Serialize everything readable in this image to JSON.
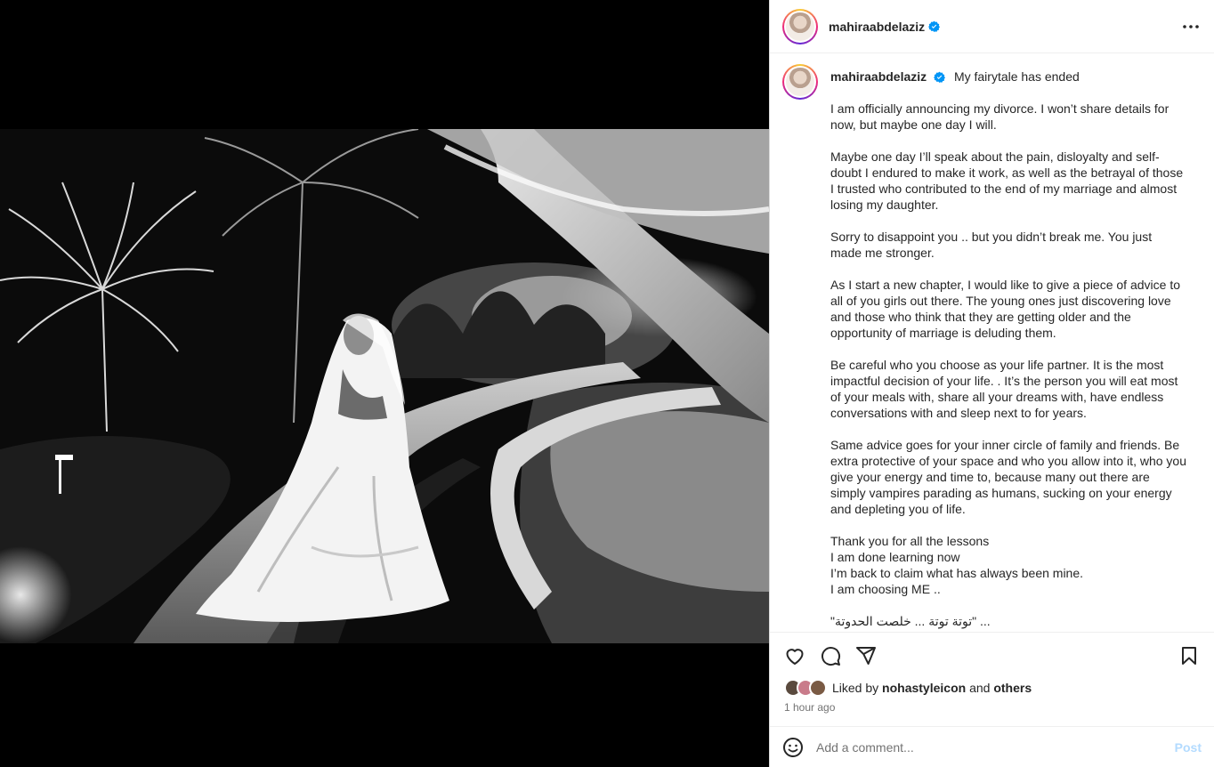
{
  "post": {
    "username": "mahiraabdelaziz",
    "more_icon": "more-horizontal-icon",
    "verified_color": "#0095f6"
  },
  "caption": {
    "username": "mahiraabdelaziz",
    "title": "My fairytale has ended",
    "text": "I am officially announcing my divorce. I won’t share details for now, but maybe one day I will.\n\nMaybe one day I’ll speak about the pain, disloyalty and self-doubt I endured to make it work, as well as the betrayal of those I trusted who contributed to the end of my marriage and almost losing my daughter.\n\nSorry to disappoint you .. but you didn’t break me. You just made me stronger.\n\nAs I start a new chapter, I would like to give a piece of advice to all of you girls out there. The young ones just discovering love and those who think that they are getting older and the opportunity of marriage is deluding them.\n\nBe careful who you choose as your life partner. It is the most impactful decision of your life. . It’s the person you will eat most of your meals with, share all your dreams with, have endless conversations with and sleep next to for years.\n\nSame advice goes for your inner circle of family and friends. Be extra protective of your space and who you allow into it, who you give your energy and time to, because many out there are simply vampires parading as humans, sucking on your energy and depleting you of life.\n\nThank you for all the lessons\nI am done learning now\nI’m back to claim what has always been mine.\nI am choosing ME ..\n\n\"توتة توتة ... خلصت الحدوتة\" ..."
  },
  "actions": {
    "icons": [
      "heart-icon",
      "comment-icon",
      "share-icon",
      "bookmark-icon"
    ]
  },
  "likes": {
    "prefix": "Liked by",
    "user": "nohastyleicon",
    "conjunction": "and",
    "others": "others"
  },
  "timestamp": "1 hour ago",
  "comment": {
    "placeholder": "Add a comment...",
    "post_label": "Post",
    "emoji_icon": "emoji-icon"
  },
  "colors": {
    "text": "#262626",
    "muted": "#737373",
    "post_disabled": "#b3dbff",
    "border": "#efefef"
  }
}
